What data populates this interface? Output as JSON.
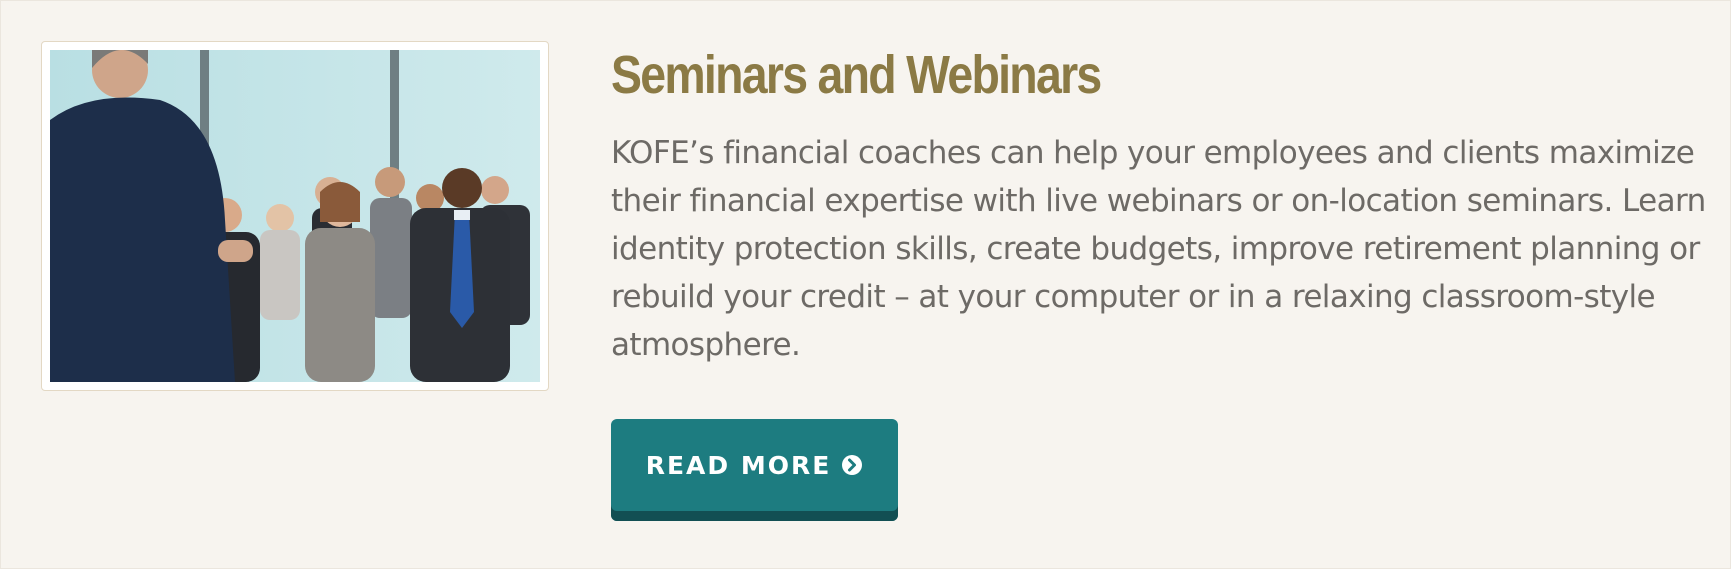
{
  "section": {
    "title": "Seminars and Webinars",
    "description": "KOFE’s financial coaches can help your employees and clients maximize their financial expertise with live webinars or on-location seminars. Learn identity protection skills, create budgets, improve retirement planning or rebuild your credit – at your computer or in a relaxing classroom-style atmosphere.",
    "button_label": "READ MORE",
    "button_icon": "circle-chevron-right-icon"
  },
  "colors": {
    "background": "#f7f4ef",
    "title": "#8b7a45",
    "body_text": "#6d6a66",
    "button": "#1d7c80",
    "button_shadow": "#124f53"
  }
}
